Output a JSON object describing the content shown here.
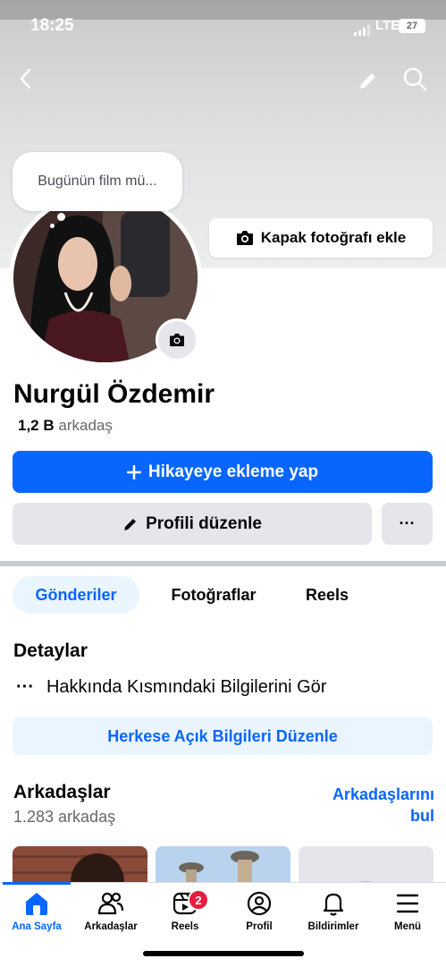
{
  "status_bar": {
    "time": "18:25",
    "network": "LTE",
    "battery": "27"
  },
  "cover": {
    "add_cover_label": "Kapak fotoğrafı ekle"
  },
  "note": {
    "text": "Bugünün film mü..."
  },
  "profile": {
    "name": "Nurgül Özdemir",
    "friends_count": "1,2 B",
    "friends_word": "arkadaş"
  },
  "actions": {
    "add_story": "Hikayeye ekleme yap",
    "edit_profile": "Profili düzenle",
    "more": "···"
  },
  "tabs": [
    {
      "label": "Gönderiler",
      "active": true
    },
    {
      "label": "Fotoğraflar",
      "active": false
    },
    {
      "label": "Reels",
      "active": false
    }
  ],
  "details": {
    "title": "Detaylar",
    "about_text": "Hakkında Kısmındaki Bilgilerini Gör",
    "edit_public": "Herkese Açık Bilgileri Düzenle"
  },
  "friends_section": {
    "title": "Arkadaşlar",
    "count_text": "1.283 arkadaş",
    "find_friends": "Arkadaşlarını bul"
  },
  "bottom_nav": [
    {
      "label": "Ana Sayfa",
      "icon": "home-icon",
      "active": true
    },
    {
      "label": "Arkadaşlar",
      "icon": "friends-icon",
      "active": false
    },
    {
      "label": "Reels",
      "icon": "reels-icon",
      "active": false,
      "badge": "2"
    },
    {
      "label": "Profil",
      "icon": "profile-icon",
      "active": false
    },
    {
      "label": "Bildirimler",
      "icon": "bell-icon",
      "active": false
    },
    {
      "label": "Menü",
      "icon": "menu-icon",
      "active": false
    }
  ],
  "colors": {
    "accent": "#0866ff",
    "badge": "#e41e3f",
    "button_gray": "#e4e6eb",
    "text_muted": "#65676b"
  }
}
